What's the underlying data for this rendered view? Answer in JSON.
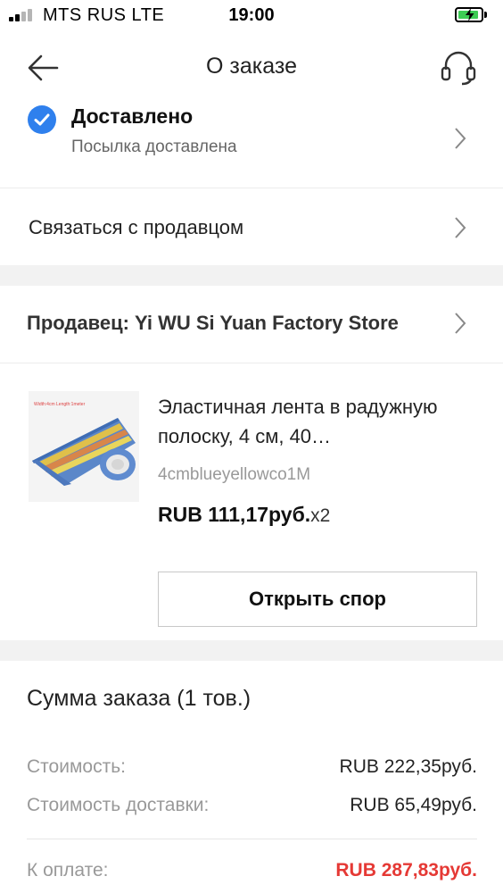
{
  "status_bar": {
    "carrier": "MTS RUS  LTE",
    "time": "19:00",
    "battery_level": 0.9,
    "battery_color": "#3dcc54"
  },
  "nav": {
    "title": "О заказе",
    "back_icon": "arrow-left-icon",
    "support_icon": "headset-icon"
  },
  "delivery": {
    "status_title": "Доставлено",
    "status_subtitle": "Посылка доставлена",
    "status_icon": "check-circle-icon",
    "accent_color": "#2f80ed"
  },
  "contact": {
    "label": "Связаться с продавцом"
  },
  "seller": {
    "label": "Продавец: Yi WU Si Yuan Factory Store"
  },
  "product": {
    "name": "Эластичная лента в радужную полоску, 4 см, 40…",
    "sku": "4cmblueyellowco1M",
    "price": "RUB 111,17руб.",
    "quantity": "x2",
    "image_caption": "Width:4cm Length:1meter",
    "dispute_label": "Открыть спор"
  },
  "summary": {
    "title": "Сумма заказа (1 тов.)",
    "rows": [
      {
        "label": "Стоимость:",
        "value": "RUB 222,35руб."
      },
      {
        "label": "Стоимость доставки:",
        "value": "RUB 65,49руб."
      }
    ],
    "total": {
      "label": "К оплате:",
      "value": "RUB 287,83руб."
    },
    "total_color": "#e53935"
  }
}
